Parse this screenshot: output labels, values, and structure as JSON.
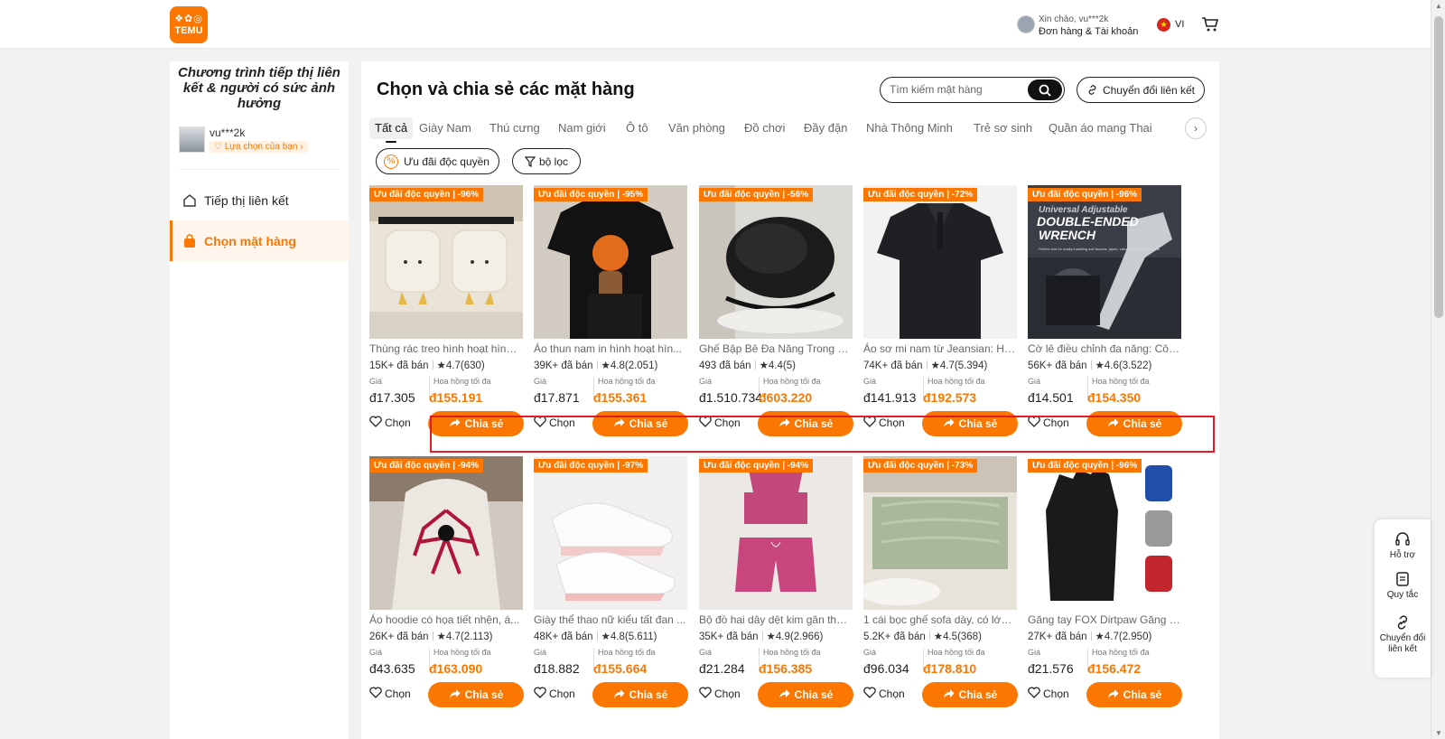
{
  "header": {
    "logo_mark": "❖✿◎",
    "logo_text": "TEMU",
    "greeting": "Xin chào, vu***2k",
    "orders_account": "Đơn hàng & Tài khoản",
    "language": "VI"
  },
  "sidebar": {
    "program_title": "Chương trình tiếp thị liên kết & người có sức ảnh hưởng",
    "user_name": "vu***2k",
    "user_badge": "♡ Lựa chọn của bạn ›",
    "nav": [
      {
        "label": "Tiếp thị liên kết",
        "icon": "home-icon",
        "active": false
      },
      {
        "label": "Chọn mặt hàng",
        "icon": "shopping-bag-icon",
        "active": true
      }
    ]
  },
  "main": {
    "title": "Chọn và chia sẻ các mặt hàng",
    "search_placeholder": "Tìm kiếm mặt hàng",
    "convert_link_label": "Chuyển đổi liên kết",
    "tabs": [
      "Tất cả",
      "Giày Nam",
      "Thú cưng",
      "Nam giới",
      "Ô tô",
      "Văn phòng",
      "Đồ chơi",
      "Đầy đặn",
      "Nhà Thông Minh",
      "Trẻ sơ sinh",
      "Quần áo mang Thai"
    ],
    "active_tab": "Tất cả",
    "filter_exclusive": "Ưu đãi độc quyền",
    "filter_label": "bộ lọc",
    "price_label": "Giá",
    "commission_label": "Hoa hồng tối đa",
    "choose_label": "Chọn",
    "share_label": "Chia sẻ",
    "products": [
      {
        "deal": "Ưu đãi độc quyền | -96%",
        "name": "Thùng rác treo hình hoạt hình ...",
        "sold": "15K+ đã bán",
        "rating": "4.7",
        "reviews": "(630)",
        "price": "đ17.305",
        "commission": "đ155.191",
        "image": "cabinet-bins"
      },
      {
        "deal": "Ưu đãi độc quyền | -95%",
        "name": "Áo thun nam in hình hoạt hìn...",
        "sold": "39K+ đã bán",
        "rating": "4.8",
        "reviews": "(2.051)",
        "price": "đ17.871",
        "commission": "đ155.361",
        "image": "black-tshirt"
      },
      {
        "deal": "Ưu đãi độc quyền | -56%",
        "name": "Ghế Bập Bê Đa Năng Trong N...",
        "sold": "493 đã bán",
        "rating": "4.4",
        "reviews": "(5)",
        "price": "đ1.510.734",
        "commission": "đ603.220",
        "image": "rocking-chair"
      },
      {
        "deal": "Ưu đãi độc quyền | -72%",
        "name": "Áo sơ mi nam từ Jeansian: Ho...",
        "sold": "74K+ đã bán",
        "rating": "4.7",
        "reviews": "(5.394)",
        "price": "đ141.913",
        "commission": "đ192.573",
        "image": "polo-shirt"
      },
      {
        "deal": "Ưu đãi độc quyền | -96%",
        "name": "Cờ lê điều chỉnh đa năng: Côn...",
        "sold": "56K+ đã bán",
        "rating": "4.6",
        "reviews": "(3.522)",
        "price": "đ14.501",
        "commission": "đ154.350",
        "image": "wrench"
      },
      {
        "deal": "Ưu đãi độc quyền | -94%",
        "name": "Áo hoodie có họa tiết nhện, á...",
        "sold": "26K+ đã bán",
        "rating": "4.7",
        "reviews": "(2.113)",
        "price": "đ43.635",
        "commission": "đ163.090",
        "image": "spider-hoodie"
      },
      {
        "deal": "Ưu đãi độc quyền | -97%",
        "name": "Giày thể thao nữ kiểu tất đan ...",
        "sold": "48K+ đã bán",
        "rating": "4.8",
        "reviews": "(5.611)",
        "price": "đ18.882",
        "commission": "đ155.664",
        "image": "sneakers"
      },
      {
        "deal": "Ưu đãi độc quyền | -94%",
        "name": "Bộ đồ hai dây dệt kim gân thư...",
        "sold": "35K+ đã bán",
        "rating": "4.9",
        "reviews": "(2.966)",
        "price": "đ21.284",
        "commission": "đ156.385",
        "image": "pink-set"
      },
      {
        "deal": "Ưu đãi độc quyền | -73%",
        "name": "1 cái bọc ghế sofa dày, có lớp ...",
        "sold": "5.2K+ đã bán",
        "rating": "4.5",
        "reviews": "(368)",
        "price": "đ96.034",
        "commission": "đ178.810",
        "image": "sofa-cover"
      },
      {
        "deal": "Ưu đãi độc quyền | -96%",
        "name": "Găng tay FOX Dirtpaw Găng t...",
        "sold": "27K+ đã bán",
        "rating": "4.7",
        "reviews": "(2.950)",
        "price": "đ21.576",
        "commission": "đ156.472",
        "image": "gloves"
      }
    ],
    "wrench_text": {
      "line1": "Universal Adjustable",
      "line2": "DOUBLE-ENDED",
      "line3": "WRENCH",
      "line4": "Perfect tool for easily installing soft faucets, pipes, valves, and other objects"
    }
  },
  "help_widget": {
    "support": "Hỗ trợ",
    "rules": "Quy tắc",
    "convert": "Chuyển đổi liên kết"
  },
  "colors": {
    "accent": "#fb7701",
    "highlight": "#e31b23"
  }
}
